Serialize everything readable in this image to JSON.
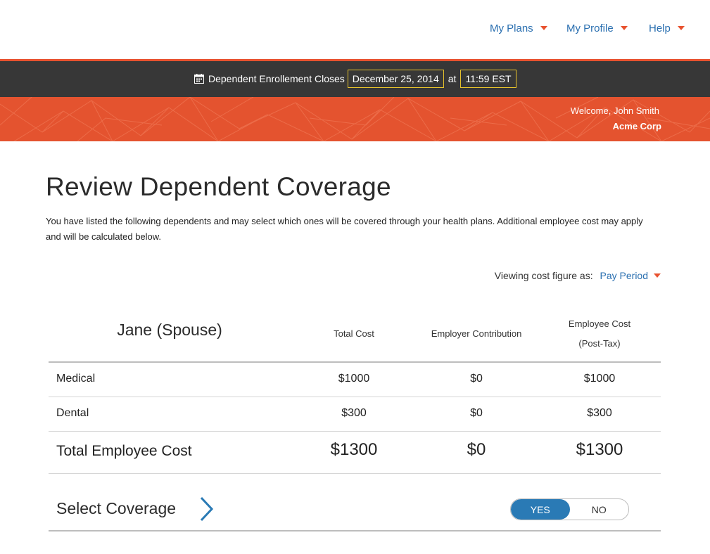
{
  "nav": {
    "items": [
      {
        "label": "My Plans"
      },
      {
        "label": "My Profile"
      },
      {
        "label": "Help"
      }
    ]
  },
  "deadline": {
    "prefix": "Dependent Enrollement Closes",
    "date": "December 25, 2014",
    "at": "at",
    "time": "11:59 EST"
  },
  "banner": {
    "welcome": "Welcome, John Smith",
    "company": "Acme Corp"
  },
  "page": {
    "title": "Review Dependent Coverage",
    "intro": "You have listed the following dependents and may select which ones will be covered through your health plans. Additional employee cost may apply and will be calculated below."
  },
  "viewing": {
    "label": "Viewing cost figure as:",
    "value": "Pay Period"
  },
  "table": {
    "dependent": "Jane (Spouse)",
    "headers": {
      "total": "Total Cost",
      "employer": "Employer Contribution",
      "employee_line1": "Employee Cost",
      "employee_line2": "(Post-Tax)"
    },
    "rows": [
      {
        "label": "Medical",
        "total": "$1000",
        "employer": "$0",
        "employee": "$1000"
      },
      {
        "label": "Dental",
        "total": "$300",
        "employer": "$0",
        "employee": "$300"
      }
    ],
    "totals": {
      "label": "Total Employee Cost",
      "total": "$1300",
      "employer": "$0",
      "employee": "$1300"
    }
  },
  "coverage": {
    "label": "Select Coverage",
    "yes": "YES",
    "no": "NO",
    "selected": "YES"
  },
  "colors": {
    "accent_orange": "#e4532f",
    "link_blue": "#2a6fb0",
    "toggle_blue": "#2a7ab5",
    "dark_bar": "#373737",
    "highlight_border": "#e6c22c"
  }
}
